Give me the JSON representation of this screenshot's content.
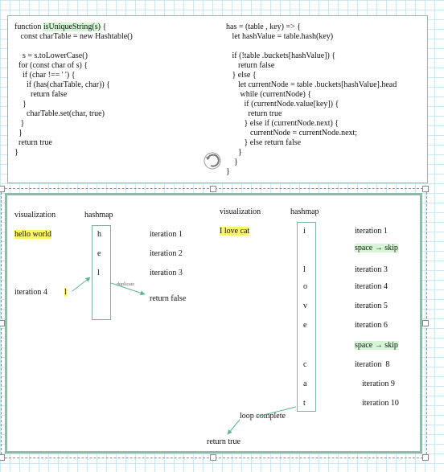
{
  "code_left": {
    "pre": "function ",
    "fn_name": "isUniqueString(s)",
    "post": " {",
    "lines": [
      "   const charTable = new Hashtable()",
      "",
      "    s = s.toLowerCase()",
      "  for (const char of s) {",
      "    if (char !== ' ') {",
      "      if (has(charTable, char)) {",
      "        return false",
      "    }",
      "      charTable.set(char, true)",
      "   }",
      "  }",
      "  return true",
      "}"
    ]
  },
  "code_right": {
    "lines": [
      "has = (table , key) => {",
      "   let hashValue = table.hash(key)",
      "",
      "   if (!table .buckets[hashValue]) {",
      "      return false",
      "   } else {",
      "      let currentNode = table .buckets[hashValue].head",
      "       while (currentNode) {",
      "         if (currentNode.value[key]) {",
      "           return true",
      "         } else if (currentNode.next) {",
      "            currentNode = currentNode.next;",
      "         } else return false",
      "      }",
      "    }",
      "}"
    ]
  },
  "example1": {
    "viz_label": "visualization",
    "hashmap_label": "hashmap",
    "input": "hello world",
    "cells": [
      "h",
      "e",
      "l"
    ],
    "iterations": [
      "iteration 1",
      "iteration 2",
      "iteration 3"
    ],
    "iteration4_label": "iteration 4",
    "iteration4_char": "l",
    "duplicate_note": "duplicate",
    "result": "return false"
  },
  "example2": {
    "viz_label": "visualization",
    "hashmap_label": "hashmap",
    "input": "I love cat",
    "cells": [
      "i",
      "l",
      "o",
      "v",
      "e",
      "c",
      "a",
      "t"
    ],
    "iterations": [
      {
        "text": "iteration 1",
        "skip": false
      },
      {
        "text": "space → skip",
        "skip": true
      },
      {
        "text": "iteration 3",
        "skip": false
      },
      {
        "text": "iteration 4",
        "skip": false
      },
      {
        "text": "iteration 5",
        "skip": false
      },
      {
        "text": "iteration 6",
        "skip": false
      },
      {
        "text": "space → skip",
        "skip": true
      },
      {
        "text": "iteration  8",
        "skip": false
      },
      {
        "text": "iteration 9",
        "skip": false
      },
      {
        "text": "iteration 10",
        "skip": false
      }
    ],
    "loop_complete": "loop complete",
    "result": "return true"
  },
  "colors": {
    "highlight": "#fff36b",
    "skip": "#d6f5d6",
    "accent": "#5fb39a"
  }
}
